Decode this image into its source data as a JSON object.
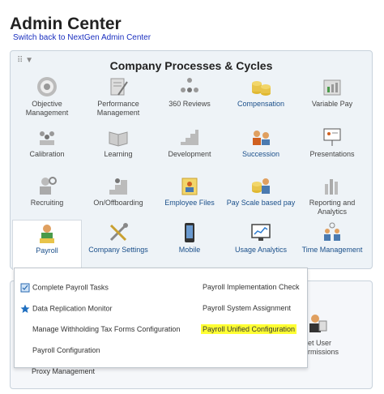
{
  "header": {
    "title": "Admin Center",
    "switch_link": "Switch back to NextGen Admin Center"
  },
  "panel": {
    "title": "Company Processes & Cycles",
    "tiles": [
      {
        "label": "Objective Management",
        "icon": "target-icon"
      },
      {
        "label": "Performance Management",
        "icon": "document-pen-icon"
      },
      {
        "label": "360 Reviews",
        "icon": "people-360-icon"
      },
      {
        "label": "Compensation",
        "icon": "coins-icon"
      },
      {
        "label": "Variable Pay",
        "icon": "chart-page-icon"
      },
      {
        "label": "Calibration",
        "icon": "group-icon"
      },
      {
        "label": "Learning",
        "icon": "book-icon"
      },
      {
        "label": "Development",
        "icon": "steps-icon"
      },
      {
        "label": "Succession",
        "icon": "succession-icon"
      },
      {
        "label": "Presentations",
        "icon": "presentation-icon"
      },
      {
        "label": "Recruiting",
        "icon": "recruiting-icon"
      },
      {
        "label": "On/Offboarding",
        "icon": "onboarding-icon"
      },
      {
        "label": "Employee Files",
        "icon": "employee-file-icon"
      },
      {
        "label": "Pay Scale based pay",
        "icon": "pay-scale-icon"
      },
      {
        "label": "Reporting and Analytics",
        "icon": "bar-report-icon"
      },
      {
        "label": "Payroll",
        "icon": "payroll-icon"
      },
      {
        "label": "Company Settings",
        "icon": "tools-icon"
      },
      {
        "label": "Mobile",
        "icon": "mobile-icon"
      },
      {
        "label": "Usage Analytics",
        "icon": "monitor-chart-icon"
      },
      {
        "label": "Time Management",
        "icon": "time-people-icon"
      }
    ]
  },
  "payroll_menu": {
    "items": [
      {
        "label": "Complete Payroll Tasks",
        "icon": "task-icon"
      },
      {
        "label": "Payroll Implementation Check",
        "icon": ""
      },
      {
        "label": "Data Replication Monitor",
        "icon": "star-icon"
      },
      {
        "label": "Payroll System Assignment",
        "icon": ""
      },
      {
        "label": "Manage Withholding Tax Forms Configuration",
        "icon": ""
      },
      {
        "label": "Payroll Unified Configuration",
        "icon": "",
        "highlight_color": "#ffff33"
      },
      {
        "label": "Payroll Configuration",
        "icon": ""
      }
    ]
  },
  "lower_panel": {
    "permissions_label_line1": "et User",
    "permissions_label_line2": "rmissions",
    "proxy_label": "Proxy Management"
  },
  "colors": {
    "link": "#1a2fbf",
    "highlight": "#ffff33",
    "panel_bg": "#eef3f7"
  }
}
